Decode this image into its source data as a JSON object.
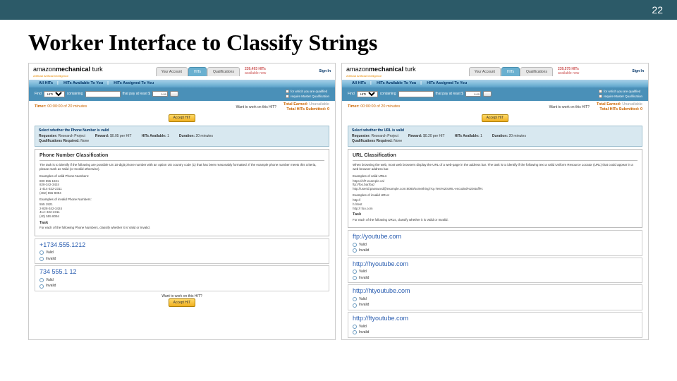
{
  "slide": {
    "number": "22",
    "title": "Worker Interface to Classify Strings"
  },
  "mturk": {
    "logo_main_1": "amazon",
    "logo_main_2": "mechanical ",
    "logo_main_3": "turk",
    "logo_sub": "Artificial Artificial Intelligence",
    "tabs": {
      "account": "Your Account",
      "hits": "HITs",
      "quals": "Qualifications"
    },
    "signin": "Sign In",
    "nav2": {
      "all": "All HITs",
      "avail": "HITs Available To You",
      "assigned": "HITs Assigned To You"
    },
    "search": {
      "find": "Find",
      "hits_opt": "HITs",
      "containing": "containing",
      "pay_label": "that pay at least $",
      "pay_val": "0.00",
      "cb1": "for which you are qualified",
      "cb2": "require Master Qualification"
    },
    "timer_label": "Timer:",
    "want": "Want to work on this HIT?",
    "earned_label": "Total Earned:",
    "earned_val": "Unavailable",
    "subs_label": "Total HITs Submitted:",
    "subs_val": "0",
    "accept": "Accept HIT",
    "info": {
      "requester_k": "Requester:",
      "requester_v": "Research Project",
      "reward_k": "Reward:",
      "avail_k": "HITs Available:",
      "avail_v": "1",
      "dur_k": "Duration:",
      "dur_v": "20 minutes",
      "quals_k": "Qualifications Required:",
      "quals_v": "None"
    },
    "radio_valid": "Valid",
    "radio_invalid": "Invalid"
  },
  "left": {
    "hits_now_n": "239,493 HITs",
    "hits_now_t": "available now",
    "timer_val": "00:00:00 of 20 minutes",
    "info_title": "Select whether the Phone Number is valid",
    "reward_v": "$0.05 per HIT",
    "task_title": "Phone Number Classification",
    "task_desc": "The task is to identify if the following are possible US 10-digit phone number with an option US country code (1) that has been reasonably formatted. If the example phone number meets this criteria, please mark as Valid (or Invalid otherwise).",
    "valid_label": "Examples of valid Phone Numbers:",
    "valid_ex": "800 555 1921\n828-342-3424\n1-414-322-2311\n(402) 555-8094",
    "invalid_label": "Examples of invalid Phone Numbers:",
    "invalid_ex": "555 1921\n2-828-342-3424\n414: 322-2311\n(40) 555 8094",
    "task_h": "Task",
    "task_instr": "For each of the following Phone Numbers, classify whether it is Valid or Invalid.",
    "items": [
      "+1734.555.1212",
      "734 555.1 12"
    ]
  },
  "right": {
    "hits_now_n": "239,575 HITs",
    "hits_now_t": "available now",
    "timer_val": "00:00:00 of 20 minutes",
    "info_title": "Select whether the URL is valid",
    "reward_v": "$0.20 per HIT",
    "task_title": "URL Classification",
    "task_desc": "When browsing the web, most web browsers display the URL of a web-page in the address bar. The task is to identify if the following text a valid Uniform Resource Locator (URL) that could appear in a web browser address bar.",
    "valid_label": "Examples of valid URLs:",
    "valid_ex": "https://sf7.example.ca/\nftp://foo.bar/baz\nhttp://userid:password@example.com:8080/something/?q=Test%20URL-encoded%20stuff#c",
    "invalid_label": "Examples of invalid URLs:",
    "invalid_ex": "http://\nh://test\nhttp:// foo.com",
    "task_h": "Task",
    "task_instr": "For each of the following URLs, classify whether it is Valid or Invalid.",
    "items": [
      "ftp://youtube.com",
      "http://hyoutube.com",
      "http://htyoutube.com",
      "http://ftyoutube.com"
    ]
  }
}
